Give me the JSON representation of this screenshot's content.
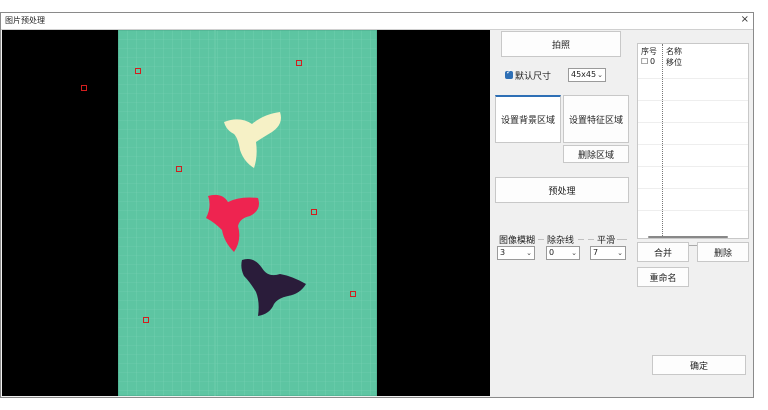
{
  "window": {
    "title": "图片预处理",
    "close_glyph": "×"
  },
  "toolbar": {
    "capture_label": "拍照",
    "default_size_label": "默认尺寸",
    "default_size_checked": true,
    "size_value": "45x45",
    "set_bg_region_label": "设置背景区域",
    "set_feature_region_label": "设置特征区域",
    "delete_region_label": "删除区域",
    "preprocess_label": "预处理"
  },
  "params": {
    "blur": {
      "label": "图像模糊",
      "value": "3"
    },
    "denoise": {
      "label": "除杂线",
      "value": "0"
    },
    "smooth": {
      "label": "平滑",
      "value": "7"
    }
  },
  "list": {
    "headers": [
      "序号",
      "名称"
    ],
    "rows": [
      {
        "index": "0",
        "name": "移位"
      }
    ]
  },
  "actions": {
    "merge_label": "合并",
    "delete_label": "删除",
    "rename_label": "重命名",
    "confirm_label": "确定"
  },
  "colors": {
    "board": "#5dc5a2",
    "marker": "#d21e1e",
    "piece_cream": "#f6f1c6",
    "piece_red": "#ee2450",
    "piece_dark": "#2a1c3a",
    "accent": "#2e6fb5"
  }
}
